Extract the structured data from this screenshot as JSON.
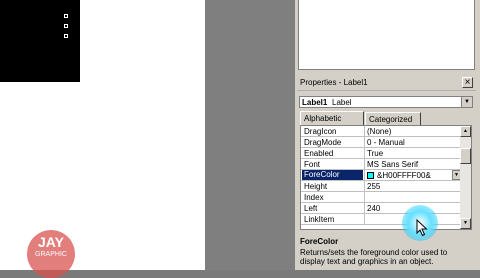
{
  "properties_window": {
    "title": "Properties - Label1",
    "close_label": "×",
    "object_name": "Label1",
    "object_type": "Label",
    "tabs": [
      {
        "label": "Alphabetic"
      },
      {
        "label": "Categorized"
      }
    ],
    "rows": [
      {
        "name": "DragIcon",
        "value": "(None)"
      },
      {
        "name": "DragMode",
        "value": "0 - Manual"
      },
      {
        "name": "Enabled",
        "value": "True"
      },
      {
        "name": "Font",
        "value": "MS Sans Serif"
      },
      {
        "name": "ForeColor",
        "value": "&H00FFFF00&"
      },
      {
        "name": "Height",
        "value": "255"
      },
      {
        "name": "Index",
        "value": ""
      },
      {
        "name": "Left",
        "value": "240"
      },
      {
        "name": "LinkItem",
        "value": ""
      }
    ],
    "selected_row": "ForeColor",
    "forecolor_swatch": "#00ffff",
    "description_title": "ForeColor",
    "description_text": "Returns/sets the foreground color used to display text and graphics in an object."
  },
  "watermark": {
    "text": "JAY",
    "subtext": "GRAPHIC"
  },
  "colors": {
    "selection": "#0a246a",
    "panel": "#d4d0c8",
    "design_gray": "#7f7f7f"
  }
}
